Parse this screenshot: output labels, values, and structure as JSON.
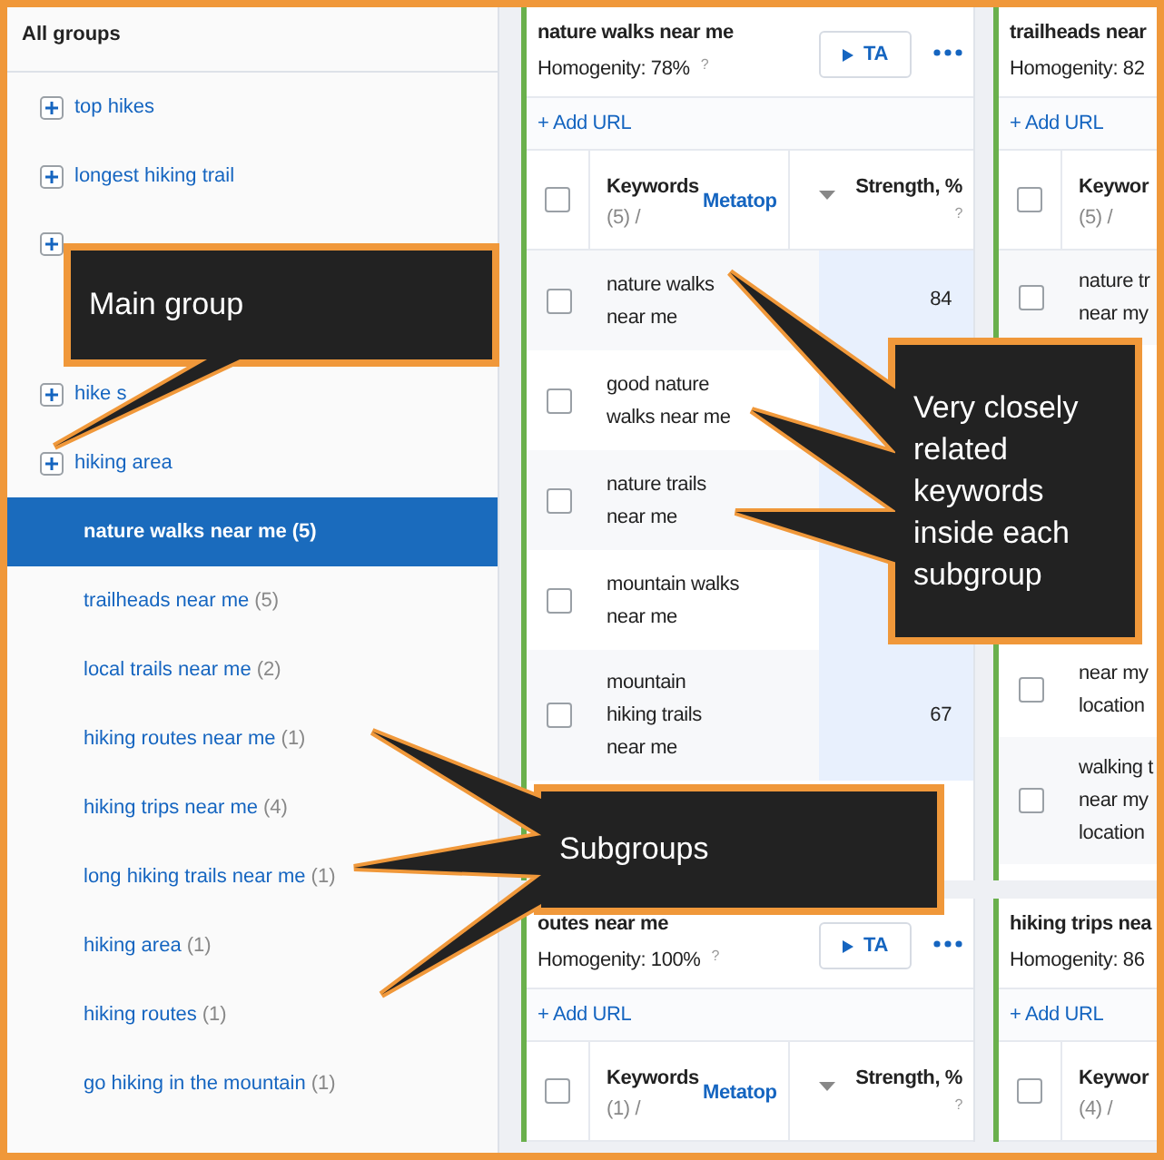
{
  "sidebar": {
    "title": "All groups",
    "items": [
      {
        "kind": "group",
        "label": "top hikes"
      },
      {
        "kind": "group",
        "label": "longest hiking trail"
      },
      {
        "kind": "group"
      },
      {
        "kind": "group",
        "label": "hike s"
      },
      {
        "kind": "group",
        "label": "hiking area"
      },
      {
        "kind": "subgroup",
        "label": "nature walks near me",
        "count": "(5)",
        "selected": true
      },
      {
        "kind": "subgroup",
        "label": "trailheads near me",
        "count": "(5)",
        "selected": false
      },
      {
        "kind": "subgroup",
        "label": "local trails near me",
        "count": "(2)",
        "selected": false
      },
      {
        "kind": "subgroup",
        "label": "hiking routes near me",
        "count": "(1)",
        "selected": false
      },
      {
        "kind": "subgroup",
        "label": "hiking trips near me",
        "count": "(4)",
        "selected": false
      },
      {
        "kind": "subgroup",
        "label": "long hiking trails near me",
        "count": "(1)",
        "selected": false
      },
      {
        "kind": "subgroup",
        "label": "hiking area",
        "count": "(1)",
        "selected": false
      },
      {
        "kind": "subgroup",
        "label": "hiking routes",
        "count": "(1)",
        "selected": false
      },
      {
        "kind": "subgroup",
        "label": "go hiking in the mountain",
        "count": "(1)",
        "selected": false
      }
    ]
  },
  "cards": [
    {
      "title": "nature walks near me",
      "homogeneity": "Homogenity: 78%",
      "help": "?",
      "ta_button": "TA",
      "add_url": "+ Add URL",
      "columns": {
        "keywords": "Keywords",
        "count": "(5) /",
        "metatop": "Metatop",
        "strength": "Strength, %",
        "help": "?",
        "checked": false
      },
      "rows": [
        {
          "kind": "keyword",
          "lines": [
            "nature walks",
            "near me"
          ],
          "strength": "84",
          "checked": false
        },
        {
          "kind": "keyword",
          "lines": [
            "good nature",
            "walks near me"
          ],
          "checked": false
        },
        {
          "kind": "keyword",
          "lines": [
            "nature trails",
            "near me"
          ],
          "checked": false
        },
        {
          "kind": "keyword",
          "lines": [
            "mountain walks",
            "near me"
          ],
          "checked": false
        },
        {
          "kind": "keyword",
          "lines": [
            "mountain",
            "hiking trails",
            "near me"
          ],
          "strength": "67",
          "checked": false
        }
      ]
    },
    {
      "title": "trailheads near",
      "homogeneity": "Homogenity: 82",
      "add_url": "+ Add URL",
      "columns": {
        "keywords": "Keywor",
        "count": "(5) /",
        "checked": false
      },
      "rows": [
        {
          "kind": "keyword",
          "lines": [
            "nature tr",
            "near my"
          ],
          "checked": false
        },
        {
          "kind": "covered"
        },
        {
          "kind": "covered"
        },
        {
          "kind": "keyword",
          "lines": [
            "near my",
            "location"
          ],
          "checked": false
        },
        {
          "kind": "keyword",
          "lines": [
            "walking t",
            "near my",
            "location"
          ],
          "checked": false
        }
      ]
    },
    {
      "title": "outes near me",
      "homogeneity": "Homogenity: 100%",
      "help": "?",
      "ta_button": "TA",
      "add_url": "+ Add URL",
      "columns": {
        "keywords": "Keywords",
        "count": "(1) /",
        "metatop": "Metatop",
        "strength": "Strength, %",
        "help": "?",
        "checked": false
      }
    },
    {
      "title": "hiking trips nea",
      "homogeneity": "Homogenity: 86",
      "add_url": "+ Add URL",
      "columns": {
        "keywords": "Keywor",
        "count": "(4) /",
        "checked": false
      }
    }
  ],
  "callouts": [
    {
      "text": "Main group"
    },
    {
      "text": "Very closely related keywords inside each subgroup"
    },
    {
      "text": "Subgroups"
    }
  ]
}
